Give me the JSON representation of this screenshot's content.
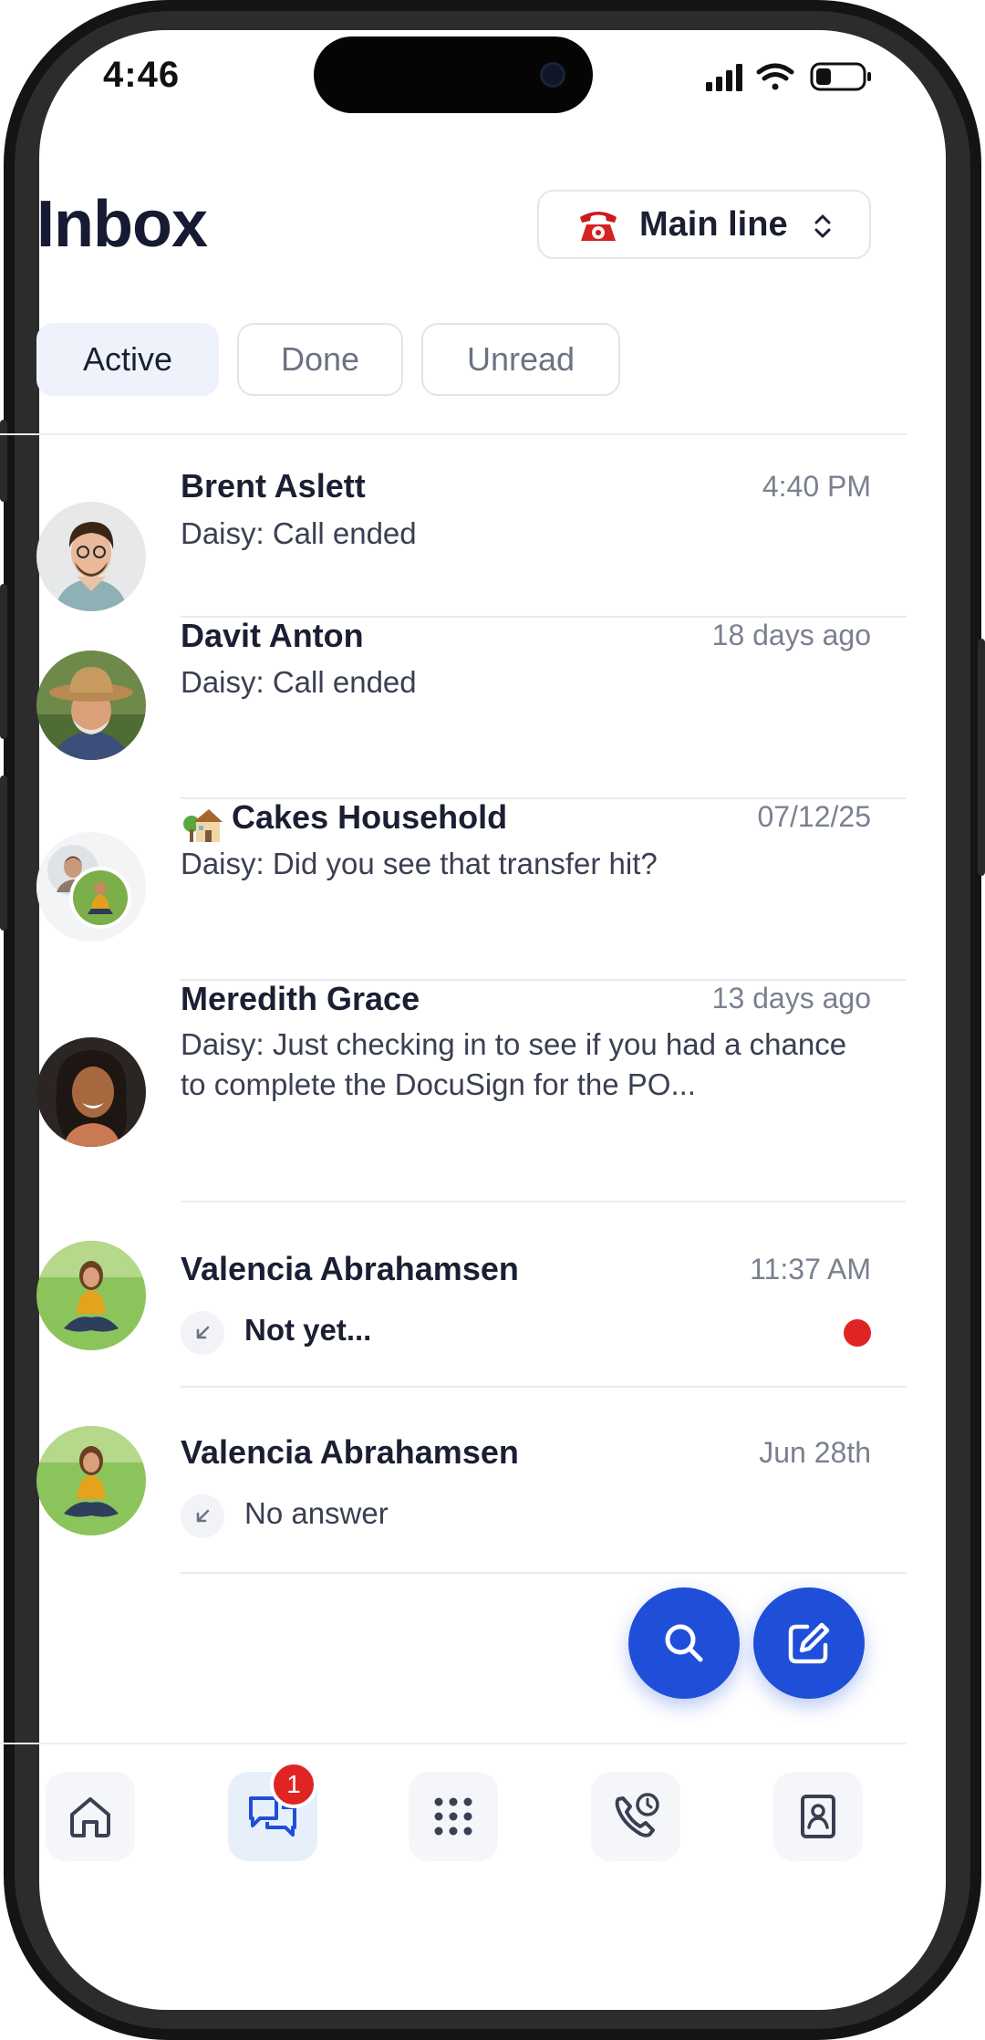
{
  "status_bar": {
    "time": "4:46"
  },
  "header": {
    "title": "Inbox",
    "line_selector": {
      "label": "Main line",
      "icon": "telephone-icon"
    }
  },
  "tabs": [
    {
      "label": "Active",
      "selected": true
    },
    {
      "label": "Done",
      "selected": false
    },
    {
      "label": "Unread",
      "selected": false
    }
  ],
  "conversations": [
    {
      "name": "Brent Aslett",
      "time": "4:40 PM",
      "preview": "Daisy: Call ended"
    },
    {
      "name": "Davit Anton",
      "time": "18 days ago",
      "preview": "Daisy: Call ended"
    },
    {
      "name": "Cakes Household",
      "time": "07/12/25",
      "preview": "Daisy: Did you see that transfer hit?",
      "icon": "house-icon"
    },
    {
      "name": "Meredith Grace",
      "time": "13 days ago",
      "preview": "Daisy: Just checking in to see if you had a chance to complete the DocuSign for the PO..."
    },
    {
      "name": "Valencia Abrahamsen",
      "time": "11:37 AM",
      "preview": "Not yet...",
      "unread": true,
      "icon": "incoming-call-icon"
    },
    {
      "name": "Valencia Abrahamsen",
      "time": "Jun 28th",
      "preview": "No answer",
      "icon": "incoming-call-icon"
    }
  ],
  "nav": {
    "items": [
      "home",
      "messages",
      "keypad",
      "calls",
      "contacts"
    ],
    "messages_badge": "1"
  },
  "colors": {
    "accent": "#1f4fd8",
    "unread": "#e02424"
  }
}
